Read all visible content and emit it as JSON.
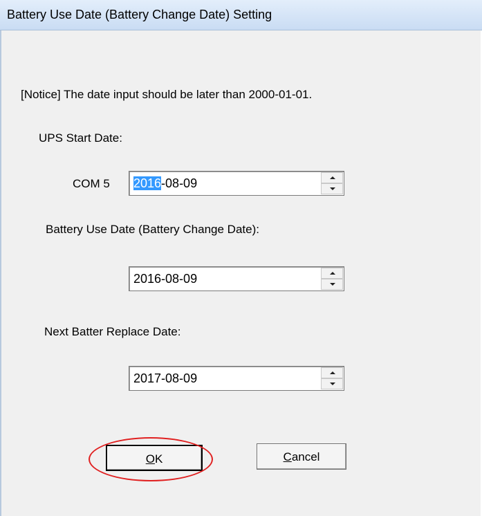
{
  "window": {
    "title": "Battery Use Date (Battery Change Date) Setting"
  },
  "dialog": {
    "notice": "[Notice] The date input should be later than 2000-01-01.",
    "ups_start_label": "UPS Start Date:",
    "com_label": "COM 5",
    "ups_start_value_selected": "2016",
    "ups_start_value_rest": "-08-09",
    "battery_use_label": "Battery Use Date (Battery Change Date):",
    "battery_use_value": "2016-08-09",
    "next_replace_label": "Next Batter Replace Date:",
    "next_replace_value": "2017-08-09"
  },
  "buttons": {
    "ok_underline": "O",
    "ok_rest": "K",
    "cancel_underline": "C",
    "cancel_rest": "ancel"
  },
  "colors": {
    "selection": "#3399ff",
    "highlight_ellipse": "#e02020"
  }
}
